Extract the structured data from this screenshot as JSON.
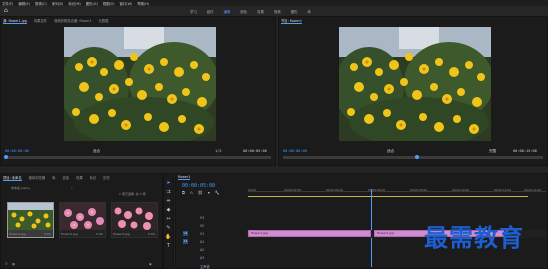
{
  "menubar": {
    "items": [
      "文件(F)",
      "编辑(E)",
      "剪辑(C)",
      "序列(S)",
      "标记(M)",
      "图形(G)",
      "视图(V)",
      "窗口(W)",
      "帮助(H)"
    ]
  },
  "workspaces": {
    "items": [
      "学习",
      "组件",
      "编辑",
      "颜色",
      "效果",
      "音频",
      "图形",
      "库"
    ],
    "active_index": 2
  },
  "source_panel": {
    "tabs": [
      "源: flower1.jpg",
      "效果控件",
      "音频剪辑混合器: flower1",
      "元数据"
    ],
    "timecode_left": "00:00:00:00",
    "fit_label": "适合",
    "fraction": "1/2",
    "timecode_right": "00:00:05:00"
  },
  "program_panel": {
    "tabs": [
      "节目: flower1"
    ],
    "timecode_left": "00:00:00:00",
    "fit_label": "适合",
    "fraction": "完整",
    "timecode_right": "00:00:15:00"
  },
  "project_panel": {
    "tabs": [
      "项目: 未命名",
      "媒体浏览器",
      "库",
      "信息",
      "效果",
      "标记",
      "历史"
    ],
    "project_file": "未命名.prproj",
    "count_text": "1 项已选择, 共 5 项",
    "items": [
      {
        "name": "flower1.jpg",
        "duration": "5:00"
      },
      {
        "name": "flower2.jpg",
        "duration": "5:00"
      },
      {
        "name": "flower3.jpg",
        "duration": "5:00"
      }
    ]
  },
  "timeline": {
    "tab": "flower1",
    "timecode": "00:00:05:00",
    "ruler_labels": [
      "00:00",
      "00:00:02:00",
      "00:00:04:00",
      "00:00:06:00",
      "00:00:08:00",
      "00:00:10:00",
      "00:00:12:00",
      "00:00:14:00"
    ],
    "tracks": [
      "V3",
      "V2",
      "V1",
      "A1",
      "A2",
      "A3"
    ],
    "master_label": "主声道",
    "clips": [
      {
        "label": "flower1.jpg"
      },
      {
        "label": "flower2.jpg"
      }
    ]
  },
  "watermark": "最需教育",
  "colors": {
    "accent": "#4d9fff",
    "clip_pink": "#d18ccf",
    "panel_bg": "#1b1b1b",
    "watermark": "#1d5fd0"
  }
}
